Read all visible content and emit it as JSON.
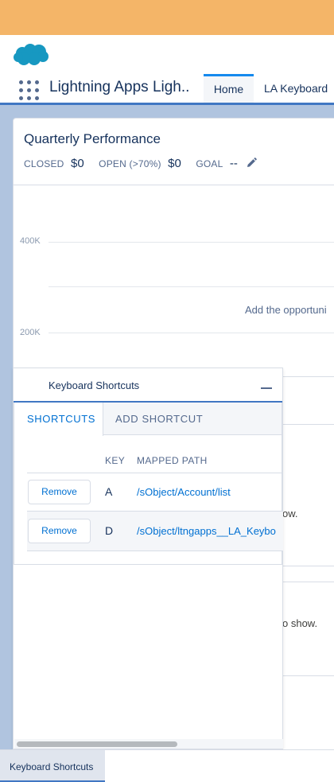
{
  "app": {
    "name": "Lightning Apps Ligh..",
    "tabs": [
      {
        "label": "Home",
        "active": true
      },
      {
        "label": "LA Keyboard",
        "active": false
      }
    ]
  },
  "card": {
    "title": "Quarterly Performance",
    "stats": [
      {
        "label": "CLOSED",
        "value": "$0"
      },
      {
        "label": "OPEN (>70%)",
        "value": "$0"
      },
      {
        "label": "GOAL",
        "value": "--"
      }
    ],
    "axis_labels": [
      "400K",
      "200K"
    ],
    "empty_message": "Add the opportuni",
    "row_text_1": "ow.",
    "row_text_2": "o show."
  },
  "panel": {
    "title": "Keyboard Shortcuts",
    "tabs": [
      {
        "label": "SHORTCUTS",
        "active": true
      },
      {
        "label": "ADD SHORTCUT",
        "active": false
      }
    ],
    "columns": {
      "key": "KEY",
      "path": "MAPPED PATH"
    },
    "rows": [
      {
        "action": "Remove",
        "key": "A",
        "path": "/sObject/Account/list"
      },
      {
        "action": "Remove",
        "key": "D",
        "path": "/sObject/ltngapps__LA_Keybo"
      }
    ]
  },
  "utility_bar": {
    "item": "Keyboard Shortcuts"
  },
  "colors": {
    "banner": "#f4b568",
    "brand_blue": "#1589ee",
    "link": "#0070d2",
    "text": "#16325c",
    "nav_underline": "#4077c3"
  },
  "icons": [
    "salesforce-cloud-icon",
    "app-launcher-icon",
    "pencil-icon",
    "minimize-icon"
  ]
}
